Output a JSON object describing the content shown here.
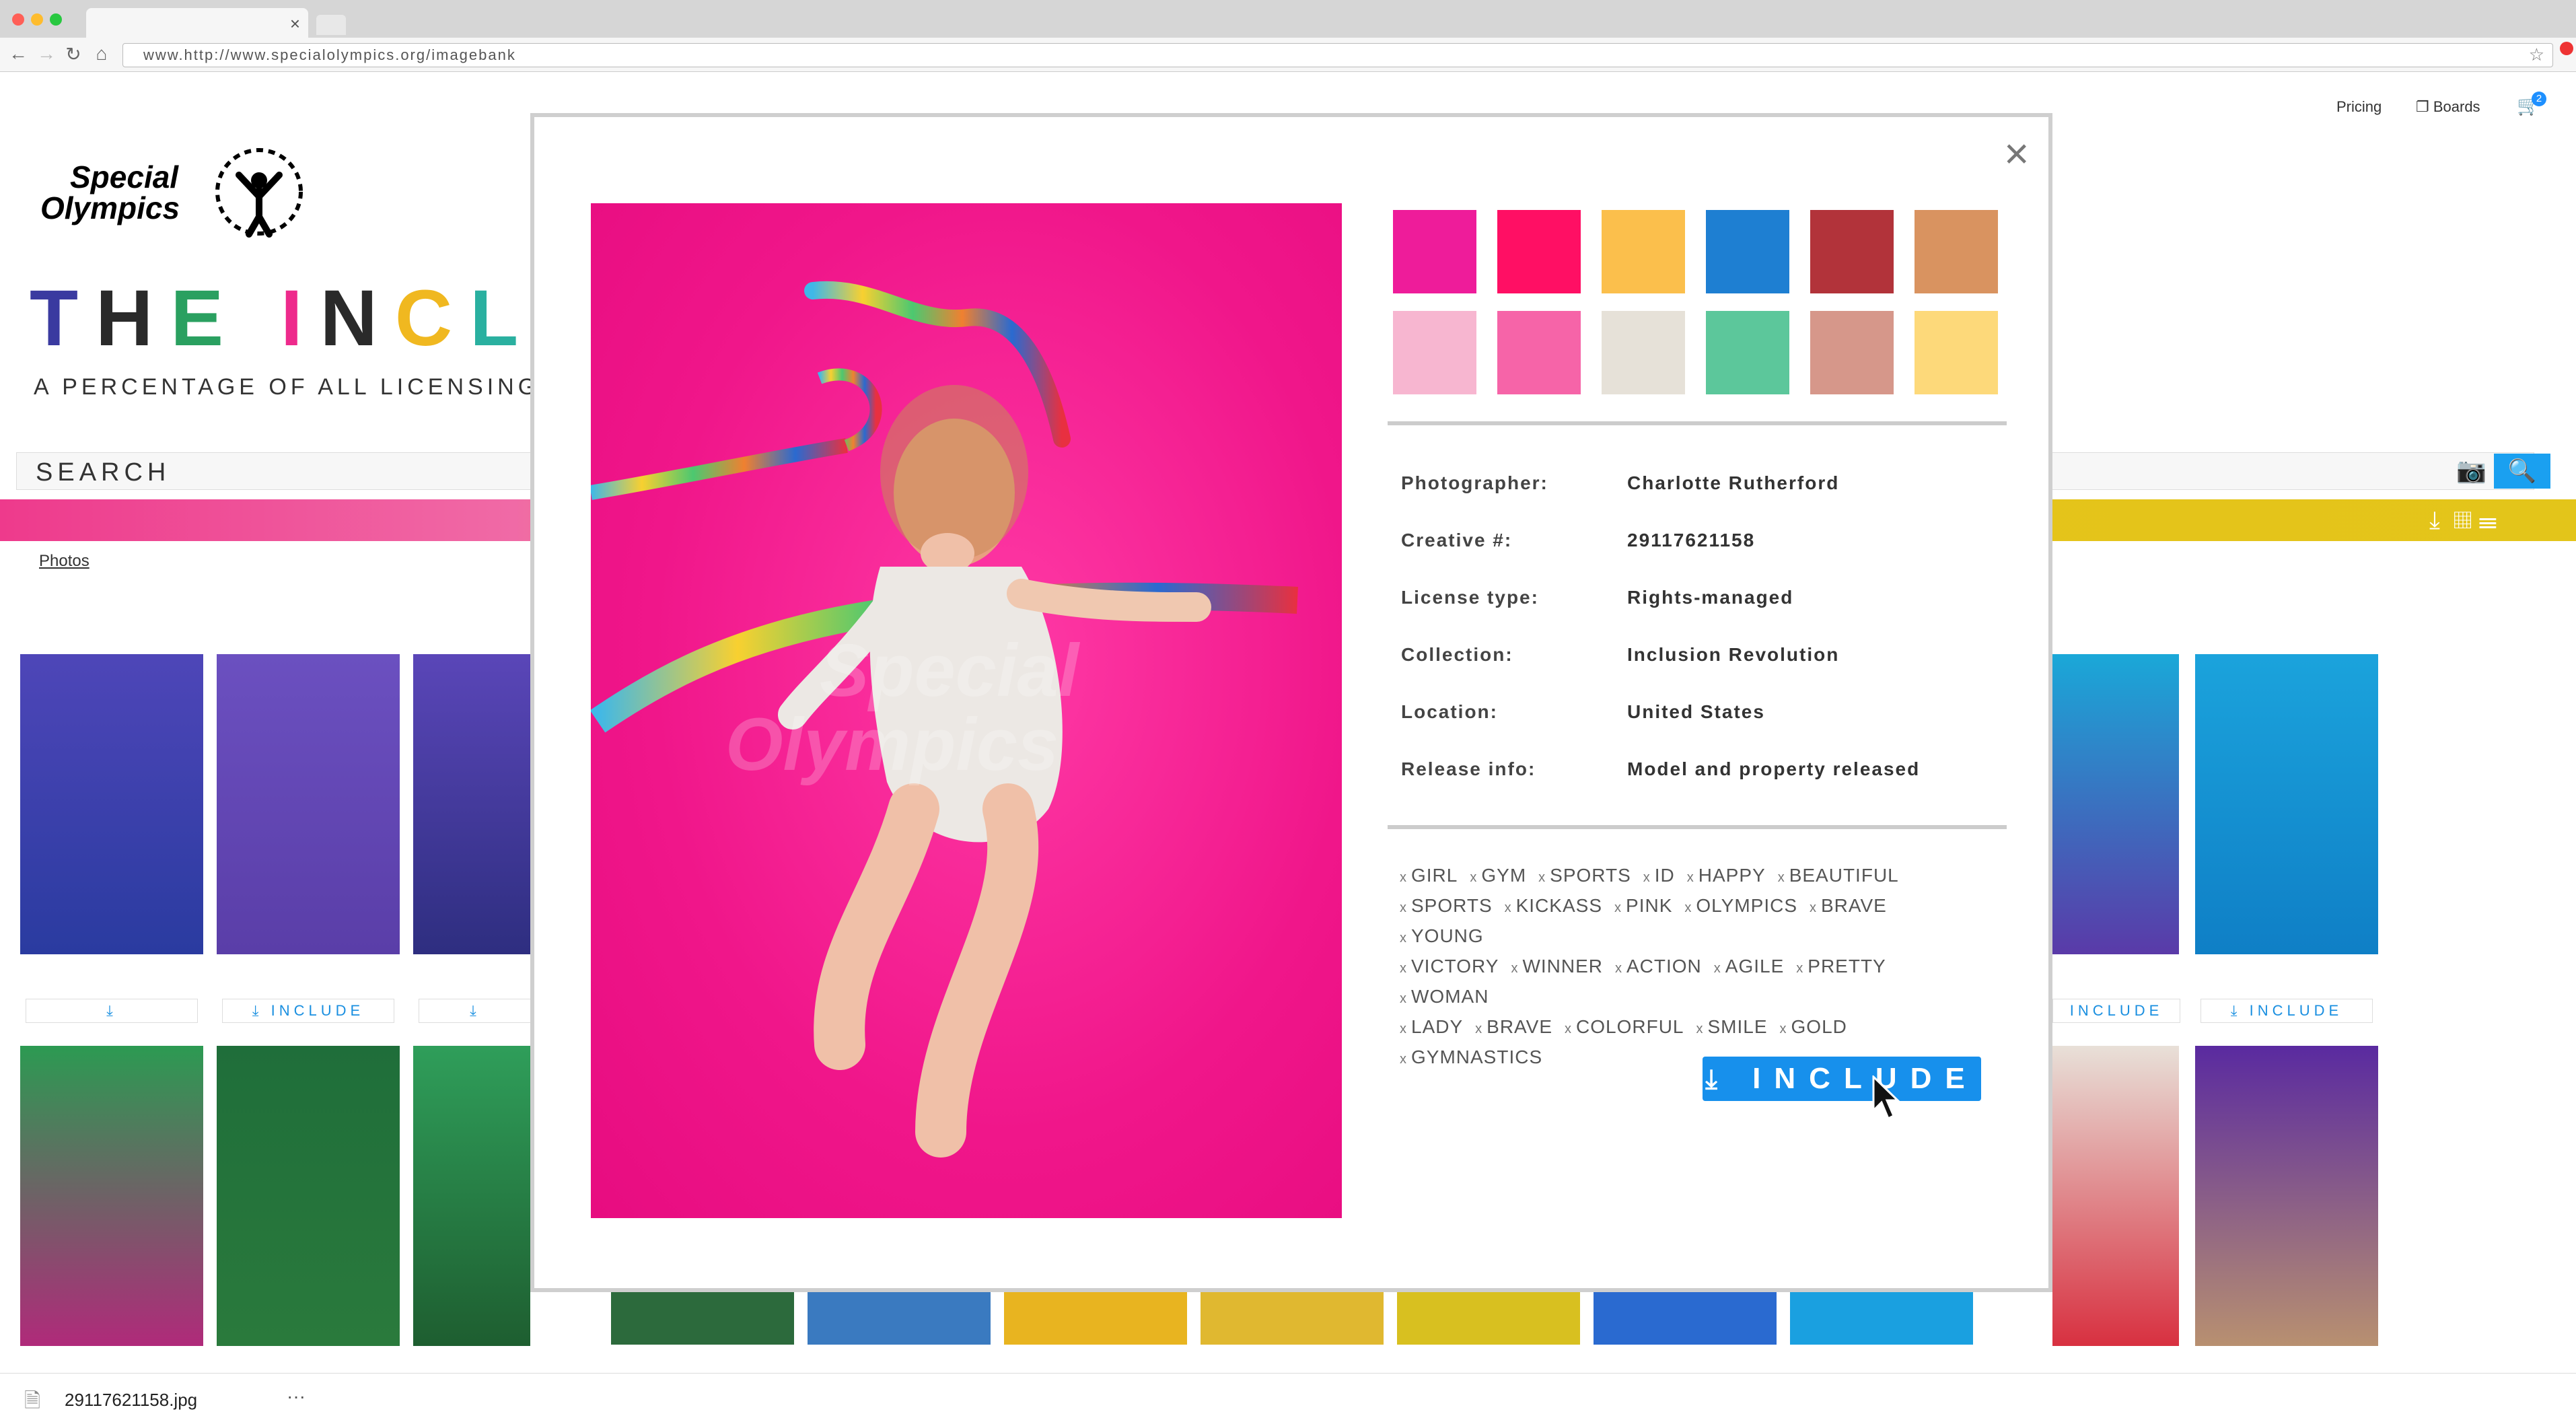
{
  "browser": {
    "url": "www.http://www.specialolympics.org/imagebank"
  },
  "header": {
    "pricing": "Pricing",
    "boards": "Boards",
    "cart_count": "2"
  },
  "brand": {
    "logo_line1": "Special",
    "logo_line2": "Olympics",
    "hero_title": "THE INCLUS",
    "hero_subtitle": "A PERCENTAGE OF ALL LICENSING CO"
  },
  "search": {
    "label": "SEARCH"
  },
  "filter": {
    "photos_tab": "Photos"
  },
  "grid": {
    "include_label": "INCLUDE"
  },
  "download_bar": {
    "filename": "29117621158.jpg",
    "more": "···"
  },
  "modal": {
    "swatches": [
      "#ee1c9a",
      "#ff0f64",
      "#fbbf4c",
      "#1e7fd2",
      "#b2333a",
      "#d99360",
      "#f7b6d0",
      "#f664a8",
      "#e6e1d8",
      "#5cc79b",
      "#d6978a",
      "#fdd97a"
    ],
    "details": [
      {
        "label": "Photographer:",
        "value": "Charlotte Rutherford"
      },
      {
        "label": "Creative #:",
        "value": "29117621158"
      },
      {
        "label": "License type:",
        "value": "Rights-managed"
      },
      {
        "label": "Collection:",
        "value": "Inclusion Revolution"
      },
      {
        "label": "Location:",
        "value": "United States"
      },
      {
        "label": "Release info:",
        "value": "Model and property released"
      }
    ],
    "tags": [
      "GIRL",
      "GYM",
      "SPORTS",
      "ID",
      "HAPPY",
      "BEAUTIFUL",
      "SPORTS",
      "KICKASS",
      "PINK",
      "OLYMPICS",
      "BRAVE",
      "YOUNG",
      "VICTORY",
      "WINNER",
      "ACTION",
      "AGILE",
      "PRETTY",
      "WOMAN",
      "LADY",
      "BRAVE",
      "COLORFUL",
      "SMILE",
      "GOLD",
      "GYMNASTICS"
    ],
    "tag_remove_glyph": "x",
    "include_button": "INCLUDE",
    "watermark_line1": "Special",
    "watermark_line2": "Olympics"
  }
}
